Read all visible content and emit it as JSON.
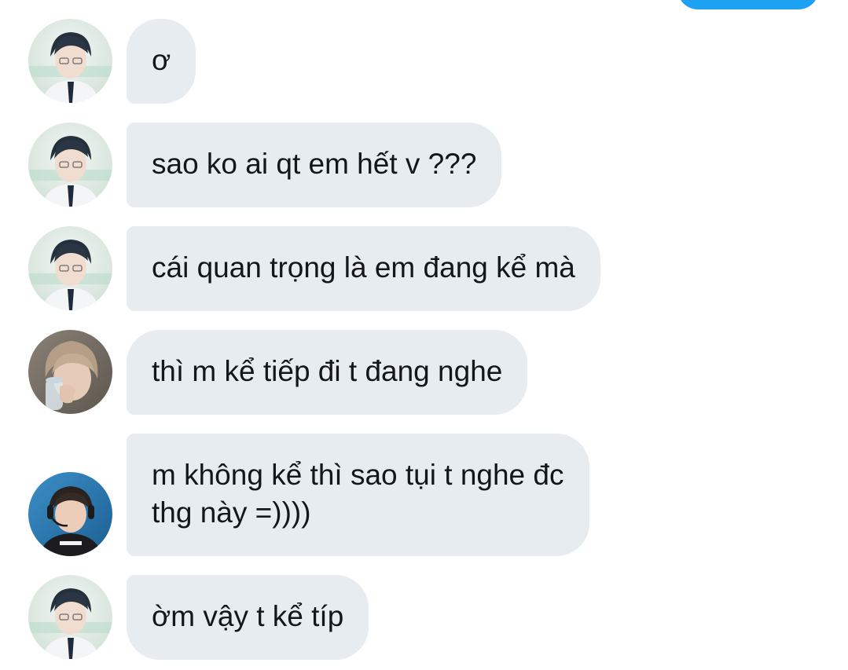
{
  "conversation": {
    "messages": [
      {
        "text": "ơ",
        "sender": "user-a",
        "avatar": "avatar-icon"
      },
      {
        "text": "sao ko ai qt em hết v ???",
        "sender": "user-a",
        "avatar": "avatar-icon"
      },
      {
        "text": "cái quan trọng là em đang kể mà",
        "sender": "user-a",
        "avatar": "avatar-icon"
      },
      {
        "text": "thì m kể tiếp đi t đang nghe",
        "sender": "user-b",
        "avatar": "avatar-icon"
      },
      {
        "text": "m không kể thì sao tụi t nghe đc\nthg này =))))",
        "sender": "user-c",
        "avatar": "avatar-icon"
      },
      {
        "text": "ờm vậy t kể típ",
        "sender": "user-a",
        "avatar": "avatar-icon"
      }
    ]
  },
  "colors": {
    "received_bubble": "#e6ecf0",
    "sent_bubble": "#1da1f2",
    "text": "#14171a"
  }
}
